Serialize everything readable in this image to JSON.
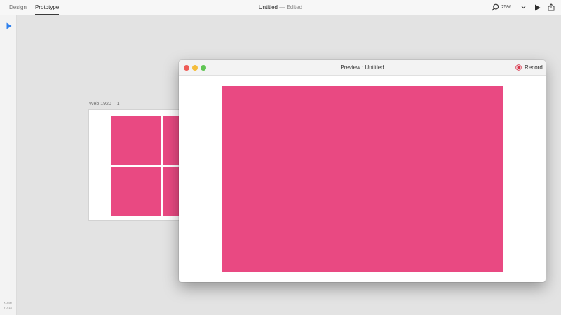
{
  "toolbar": {
    "tabs": [
      "Design",
      "Prototype"
    ],
    "active_tab": "Prototype",
    "doc_name": "Untitled",
    "doc_status": " — Edited",
    "zoom": "25%",
    "icons": [
      "search-icon",
      "chevron-down-icon",
      "play-icon",
      "share-icon"
    ]
  },
  "left_tools": {
    "select_icon": "select-arrow-icon",
    "coord_x": "X  -650",
    "coord_y": "Y  -918"
  },
  "artboard": {
    "label": "Web 1920 – 1",
    "tile_color": "#e94982"
  },
  "preview": {
    "title": "Preview : Untitled",
    "record_label": "Record",
    "canvas_color": "#e94982",
    "traffic_lights": [
      "#ee5c57",
      "#f5bd3b",
      "#5fc553"
    ]
  }
}
